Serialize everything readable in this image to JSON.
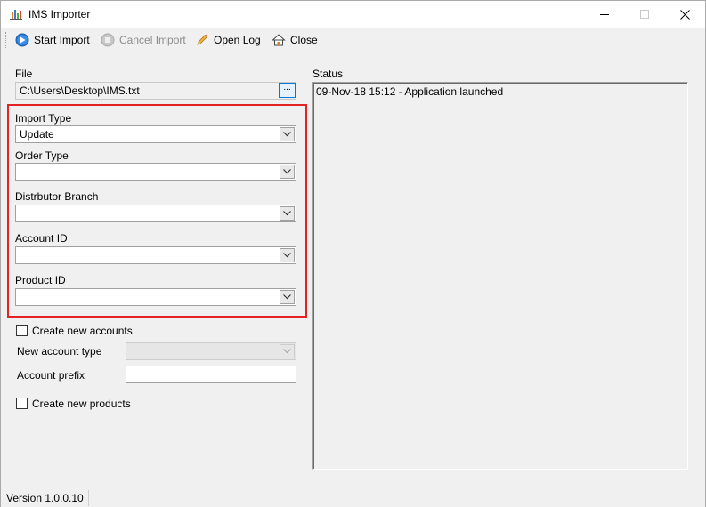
{
  "window": {
    "title": "IMS Importer",
    "icons": {
      "app": "bar-chart-icon",
      "minimize": "minimize-icon",
      "maximize": "maximize-icon",
      "close": "close-icon"
    }
  },
  "toolbar": {
    "start_label": "Start Import",
    "start_icon": "play-icon",
    "cancel_label": "Cancel Import",
    "cancel_icon": "stop-icon",
    "cancel_enabled": false,
    "openlog_label": "Open Log",
    "openlog_icon": "pencil-icon",
    "close_label": "Close",
    "close_icon": "home-icon"
  },
  "form": {
    "file_label": "File",
    "file_value": "C:\\Users\\Desktop\\IMS.txt",
    "browse_label": "...",
    "import_type_label": "Import Type",
    "import_type_value": "Update",
    "order_type_label": "Order Type",
    "order_type_value": "",
    "distributor_branch_label": "Distrbutor Branch",
    "distributor_branch_value": "",
    "account_id_label": "Account ID",
    "account_id_value": "",
    "product_id_label": "Product ID",
    "product_id_value": "",
    "create_accounts_label": "Create new accounts",
    "create_accounts_checked": false,
    "new_account_type_label": "New account type",
    "new_account_type_value": "",
    "new_account_type_enabled": false,
    "account_prefix_label": "Account prefix",
    "account_prefix_value": "",
    "create_products_label": "Create new products",
    "create_products_checked": false
  },
  "status": {
    "label": "Status",
    "lines": [
      "09-Nov-18 15:12 - Application launched"
    ]
  },
  "statusbar": {
    "version": "Version 1.0.0.10"
  },
  "colors": {
    "highlight": "#e32223",
    "accent": "#0078d7"
  }
}
